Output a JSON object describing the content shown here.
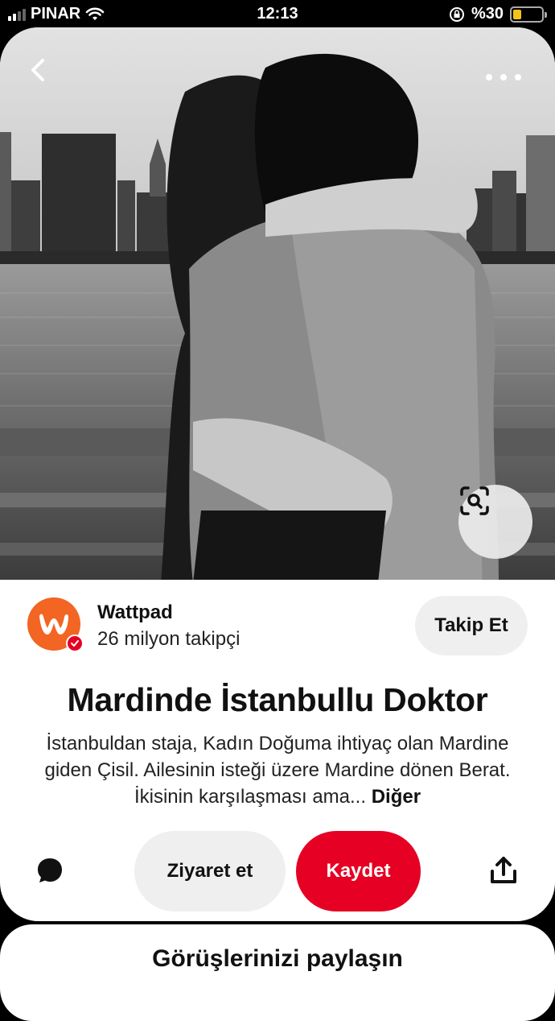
{
  "status_bar": {
    "carrier": "PINAR",
    "time": "12:13",
    "battery_text": "%30",
    "battery_level": 0.3,
    "icons": [
      "signal-icon",
      "wifi-icon",
      "orientation-lock-icon",
      "battery-icon"
    ]
  },
  "hero": {
    "icons": [
      "back-arrow-icon",
      "more-dots-icon",
      "visual-search-icon"
    ]
  },
  "creator": {
    "name": "Wattpad",
    "followers": "26 milyon takipçi",
    "follow_label": "Takip Et",
    "brand_color": "#f26522"
  },
  "pin": {
    "title": "Mardinde İstanbullu Doktor",
    "description": "İstanbuldan staja, Kadın Doğuma ihtiyaç olan Mardine giden Çisil. Ailesinin isteği üzere Mardine dönen Berat. İkisinin karşılaşması ama...",
    "more_label": "Diğer"
  },
  "actions": {
    "visit_label": "Ziyaret et",
    "save_label": "Kaydet",
    "save_color": "#e60023",
    "icons": [
      "comment-icon",
      "share-icon"
    ]
  },
  "comments_section": {
    "title": "Görüşlerinizi paylaşın"
  }
}
